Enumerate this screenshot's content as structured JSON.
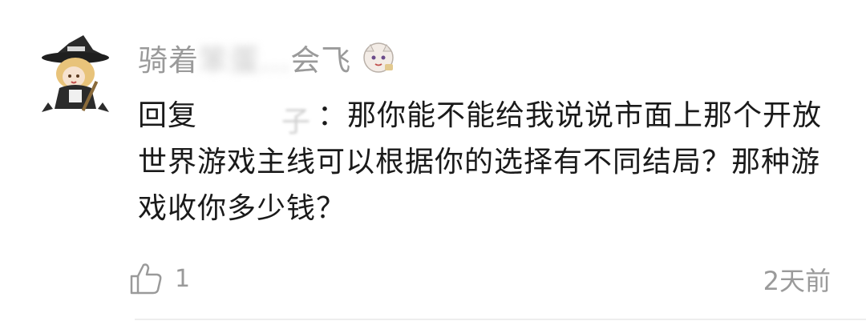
{
  "comment": {
    "username_visible_start": "骑着",
    "username_obscured": "笨蛋...",
    "username_visible_end": "会飞",
    "reply_prefix": "回复",
    "reply_target_tail": "子",
    "reply_separator": "：",
    "body": "那你能不能给我说说市面上那个开放世界游戏主线可以根据你的选择有不同结局？那种游戏收你多少钱？",
    "like_count": "1",
    "timestamp": "2天前"
  },
  "icons": {
    "avatar": "witch-girl-avatar",
    "emote": "chibi-character-emote-icon",
    "like": "thumbs-up-icon"
  }
}
